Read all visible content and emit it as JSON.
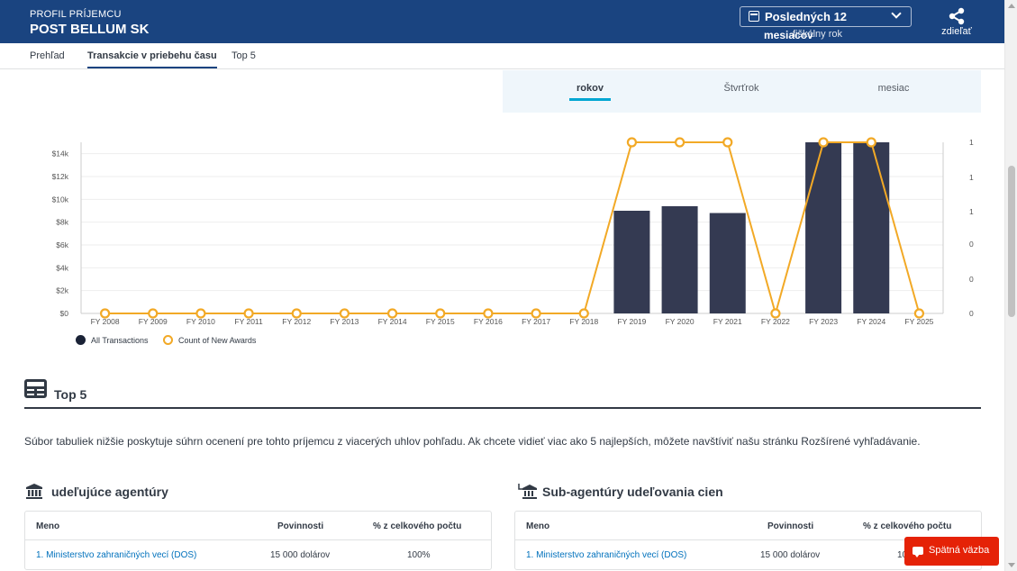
{
  "header": {
    "eyebrow": "PROFIL PRÍJEMCU",
    "title": "POST BELLUM SK",
    "fy_select_label": "Posledných 12",
    "fy_select_sub": "mesiacov",
    "fy_select_sub2": "fiškálny rok",
    "share_label": "zdieľať"
  },
  "tabs": [
    {
      "label": "Prehľad",
      "active": false
    },
    {
      "label": "Transakcie v priebehu času",
      "active": true
    },
    {
      "label": "Top 5",
      "active": false
    }
  ],
  "period": {
    "options": [
      "rokov",
      "Štvrťrok",
      "mesiac"
    ],
    "active": "rokov"
  },
  "chart_data": {
    "type": "bar",
    "categories": [
      "FY 2008",
      "FY 2009",
      "FY 2010",
      "FY 2011",
      "FY 2012",
      "FY 2013",
      "FY 2014",
      "FY 2015",
      "FY 2016",
      "FY 2017",
      "FY 2018",
      "FY 2019",
      "FY 2020",
      "FY 2021",
      "FY 2022",
      "FY 2023",
      "FY 2024",
      "FY 2025"
    ],
    "series": [
      {
        "name": "All Transactions",
        "kind": "bar",
        "axis": "left",
        "color": "#343a52",
        "values": [
          0,
          0,
          0,
          0,
          0,
          0,
          0,
          0,
          0,
          0,
          0,
          9000,
          9400,
          8800,
          0,
          15000,
          15000,
          0
        ]
      },
      {
        "name": "Count of New Awards",
        "kind": "line",
        "axis": "right",
        "color": "#f2a926",
        "values": [
          0,
          0,
          0,
          0,
          0,
          0,
          0,
          0,
          0,
          0,
          0,
          1,
          1,
          1,
          0,
          1,
          1,
          0
        ]
      }
    ],
    "left_axis": {
      "ticks": [
        "$0",
        "$2k",
        "$4k",
        "$6k",
        "$8k",
        "$10k",
        "$12k",
        "$14k"
      ],
      "tick_values": [
        0,
        2000,
        4000,
        6000,
        8000,
        10000,
        12000,
        14000
      ],
      "max": 15000
    },
    "right_axis": {
      "ticks": [
        "0",
        "0",
        "0",
        "1",
        "1",
        "1"
      ],
      "max": 1
    },
    "legend_position": "bottom-left",
    "grid": true
  },
  "top5": {
    "title": "Top 5",
    "description": "Súbor tabuliek nižšie poskytuje súhrn ocenení pre tohto príjemcu z viacerých uhlov pohľadu. Ak chcete vidieť viac ako 5 najlepších, môžete navštíviť našu stránku Rozšírené vyhľadávanie.",
    "left_table": {
      "title": "udeľujúce agentúry",
      "headers": [
        "Meno",
        "Povinnosti",
        "% z celkového počtu"
      ],
      "rows": [
        [
          "1. Ministerstvo zahraničných vecí (DOS)",
          "15 000 dolárov",
          "100%"
        ]
      ]
    },
    "right_table": {
      "title": "Sub-agentúry udeľovania cien",
      "headers": [
        "Meno",
        "Povinnosti",
        "% z celkového počtu"
      ],
      "rows": [
        [
          "1. Ministerstvo zahraničných vecí (DOS)",
          "15 000 dolárov",
          "100%"
        ]
      ]
    }
  },
  "feedback": {
    "label": "Spätná väzba"
  }
}
